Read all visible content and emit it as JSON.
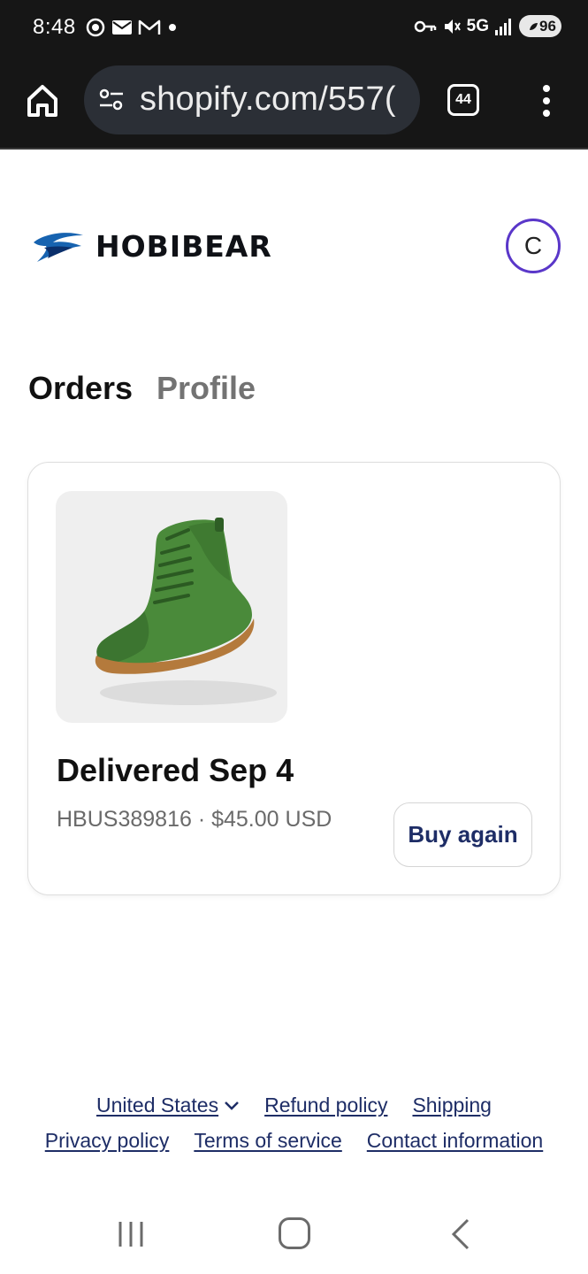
{
  "status_bar": {
    "time": "8:48",
    "network": "5G",
    "battery": "96",
    "icons": [
      "vpn-app-icon",
      "mail-icon",
      "gmail-icon",
      "notification-dot-icon",
      "vpn-key-icon",
      "mute-icon",
      "signal-icon"
    ]
  },
  "browser": {
    "url": "shopify.com/557(",
    "tab_count": "44",
    "icons": [
      "home-icon",
      "site-settings-icon",
      "more-vert-icon"
    ]
  },
  "store": {
    "name": "HOBIBEAR",
    "avatar_initial": "C"
  },
  "tabs": [
    {
      "label": "Orders",
      "active": true
    },
    {
      "label": "Profile",
      "active": false
    }
  ],
  "order": {
    "status": "Delivered Sep 4",
    "meta": "HBUS389816 · $45.00 USD",
    "buy_again_label": "Buy again",
    "product_image": "green-high-top-shoe"
  },
  "footer": {
    "country": "United States",
    "links_row1": [
      "Refund policy",
      "Shipping"
    ],
    "links_row2": [
      "Privacy policy",
      "Terms of service",
      "Contact information"
    ]
  },
  "colors": {
    "accent_navy": "#1e2d66",
    "avatar_ring": "#5a37c9",
    "logo_blue": "#1763b0"
  }
}
